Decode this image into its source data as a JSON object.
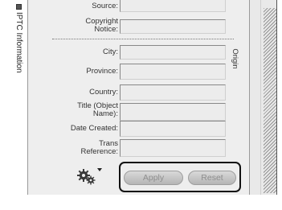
{
  "sidebar": {
    "tab_label": "IPTC Information"
  },
  "fields": [
    {
      "label": "Source:",
      "value": ""
    },
    {
      "label": "Copyright\nNotice:",
      "value": ""
    },
    {
      "label": "City:",
      "value": ""
    },
    {
      "label": "Province:",
      "value": ""
    },
    {
      "label": "Country:",
      "value": ""
    },
    {
      "label": "Title (Object\nName):",
      "value": ""
    },
    {
      "label": "Date Created:",
      "value": ""
    },
    {
      "label": "Trans\nReference:",
      "value": ""
    }
  ],
  "section": {
    "origin_label": "Origin"
  },
  "actions": {
    "apply_label": "Apply",
    "reset_label": "Reset",
    "apply_enabled": false,
    "reset_enabled": false
  },
  "icons": {
    "menu": "gear-icon",
    "menu_caret": "caret-down-icon"
  }
}
